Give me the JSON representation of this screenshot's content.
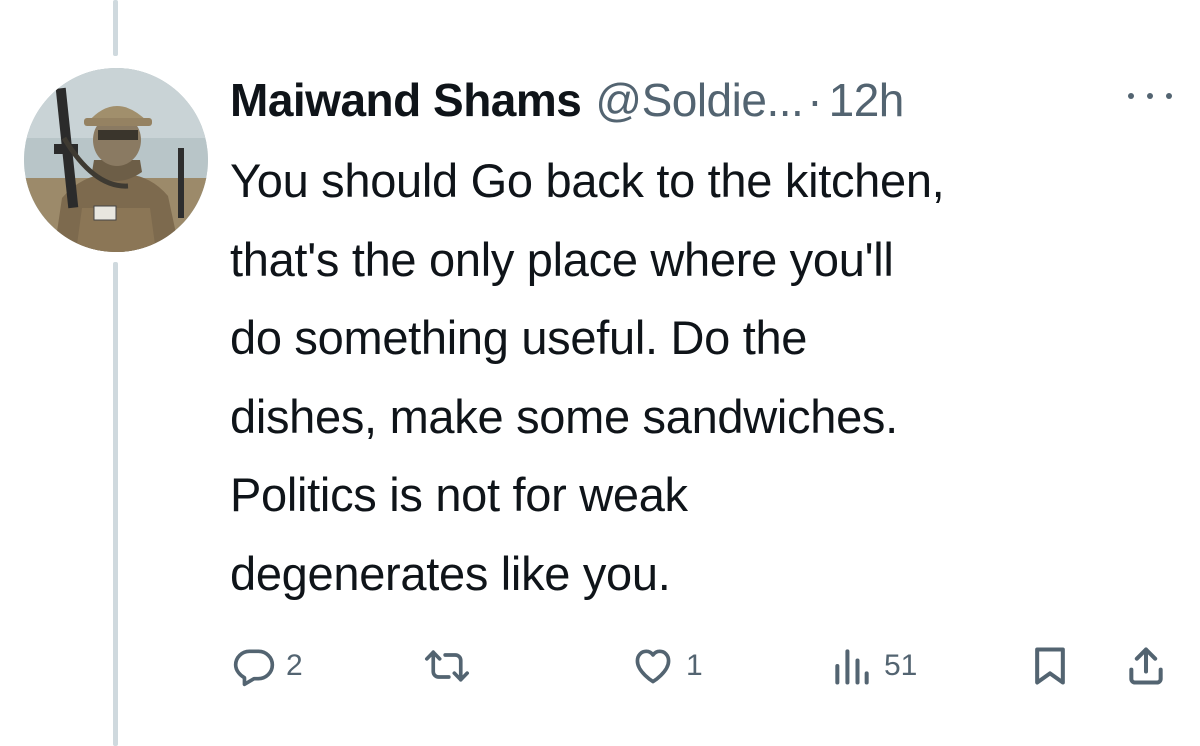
{
  "tweet": {
    "author": {
      "display_name": "Maiwand Shams",
      "handle": "@Soldie...",
      "avatar": "soldier-avatar-photo"
    },
    "separator": "·",
    "time": "12h",
    "more_icon": "more-horizontal-icon",
    "text_lines": [
      "You should Go back to the kitchen,",
      "that's the only place where you'll",
      "do something useful. Do the",
      "dishes, make some sandwiches.",
      "Politics is not for weak",
      "degenerates like you."
    ],
    "actions": {
      "reply": {
        "icon": "reply-icon",
        "count": "2"
      },
      "retweet": {
        "icon": "retweet-icon",
        "count": ""
      },
      "like": {
        "icon": "heart-icon",
        "count": "1"
      },
      "views": {
        "icon": "views-icon",
        "count": "51"
      },
      "bookmark": {
        "icon": "bookmark-icon"
      },
      "share": {
        "icon": "share-icon"
      }
    }
  },
  "colors": {
    "text_primary": "#0f1419",
    "text_secondary": "#536471",
    "thread_line": "#cfd9de",
    "background": "#ffffff"
  }
}
